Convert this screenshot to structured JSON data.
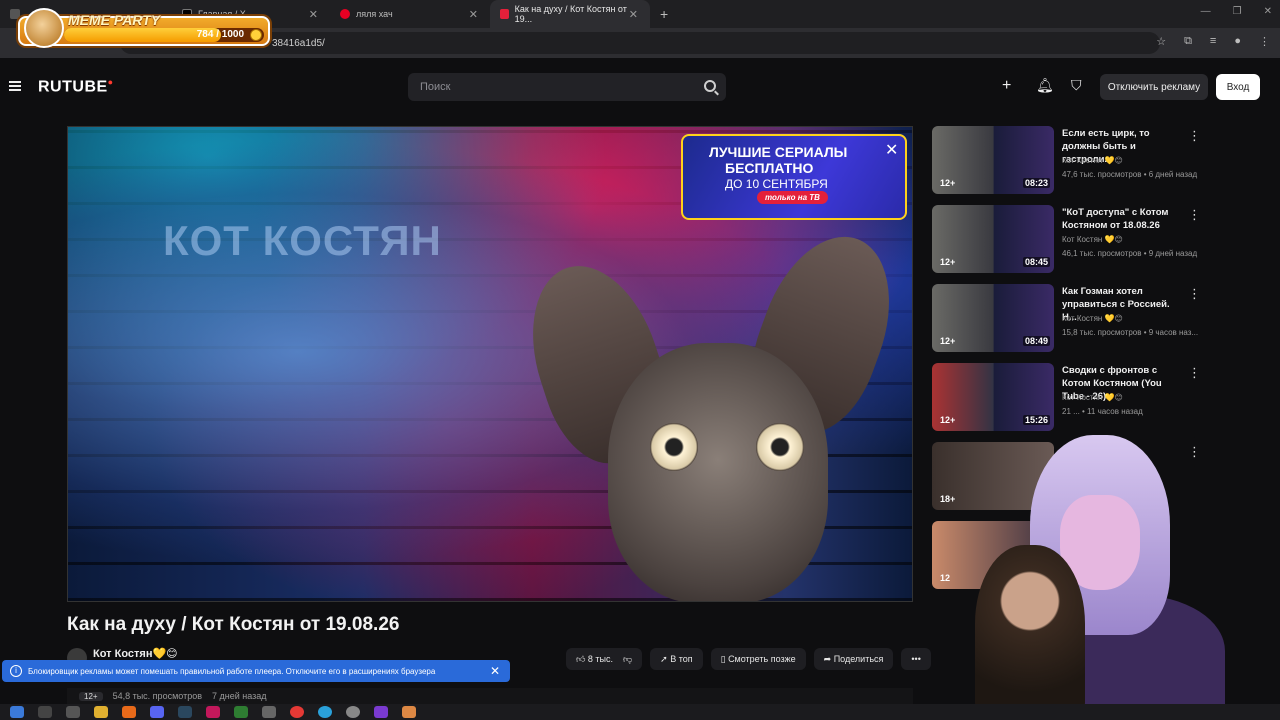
{
  "browser": {
    "tabs": [
      {
        "label": "",
        "icon": "app-icon"
      },
      {
        "label": "Главная / X",
        "icon": "x-icon"
      },
      {
        "label": "ляля хач",
        "icon": "pinterest-icon"
      },
      {
        "label": "Как на духу / Кот Костян от 19...",
        "icon": "rutube-icon"
      }
    ],
    "address_fragment": "38416a1d5/",
    "new_tab": "+"
  },
  "overlay_widget": {
    "title": "MEME PARTY",
    "progress_text": "784 / 1000",
    "progress_fraction": 0.784
  },
  "header": {
    "logo": "RUTUBE",
    "search_placeholder": "Поиск",
    "disable_ads": "Отключить рекламу",
    "login": "Вход"
  },
  "player": {
    "watermark": "КОТ КОСТЯН",
    "ad": {
      "line1": "ЛУЧШИЕ СЕРИАЛЫ",
      "line2": "БЕСПЛАТНО",
      "line3": "ДО 10 СЕНТЯБРЯ",
      "pill": "только на ТВ"
    }
  },
  "video": {
    "title": "Как на духу / Кот Костян от 19.08.26",
    "channel": "Кот Костян💛😊",
    "likes": "8 тыс.",
    "actions": {
      "top": "В топ",
      "later": "Смотреть позже",
      "share": "Поделиться"
    },
    "age": "12+",
    "views": "54,8 тыс. просмотров",
    "date": "7 дней назад"
  },
  "blocker_notice": "Блокировщик рекламы может помешать правильной работе плеера. Отключите его в расширениях браузера",
  "recommendations": [
    {
      "title": "Если есть цирк, то должны быть и гастроли...",
      "channel": "Кот Костян 💛😊",
      "stats": "47,6 тыс. просмотров • 6 дней назад",
      "age": "12+",
      "duration": "08:23"
    },
    {
      "title": "\"КоТ доступа\" с Котом Костяном от 18.08.26",
      "channel": "Кот Костян 💛😊",
      "stats": "46,1 тыс. просмотров • 9 дней назад",
      "age": "12+",
      "duration": "08:45"
    },
    {
      "title": "Как Гозман хотел управиться с Россией. Н...",
      "channel": "Кот Костян 💛😊",
      "stats": "15,8 тыс. просмотров • 9 часов наз...",
      "age": "12+",
      "duration": "08:49"
    },
    {
      "title": "Сводки с фронтов с Котом Костяном (You Tube - 26)",
      "channel": "Кот Костян 💛😊",
      "stats": "21 ... • 11 часов назад",
      "age": "12+",
      "duration": "15:26"
    },
    {
      "title": "",
      "channel": "",
      "stats": "",
      "age": "18+",
      "duration": ""
    },
    {
      "title": "",
      "channel": "",
      "stats": "",
      "age": "12",
      "duration": ""
    }
  ],
  "colors": {
    "accent_red": "#ff3a2f",
    "notice_blue": "#2a6ad9",
    "bg": "#0e0e10"
  }
}
